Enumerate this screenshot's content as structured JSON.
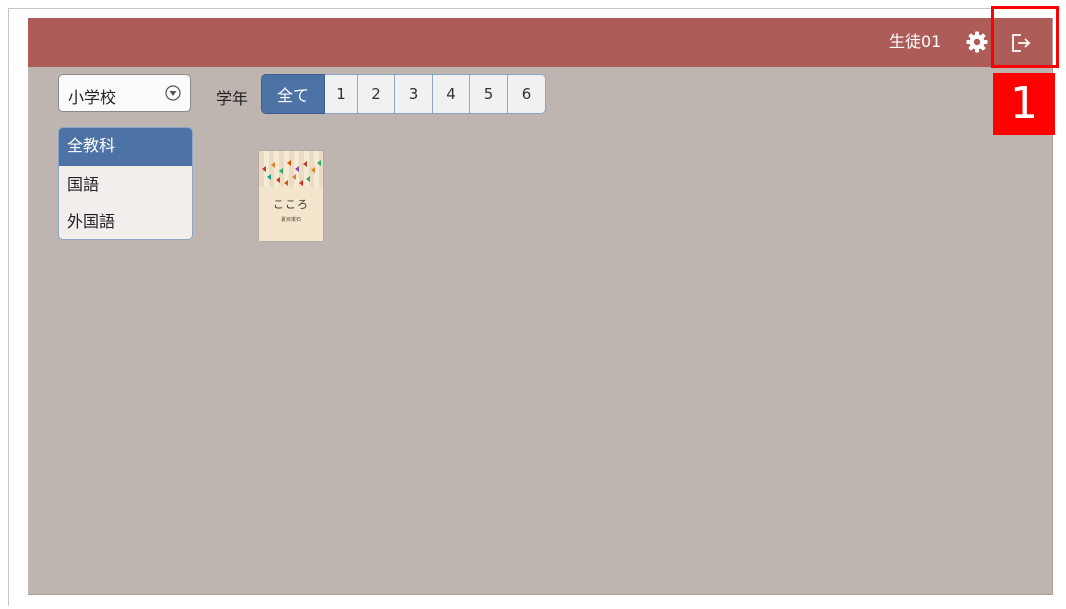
{
  "header": {
    "username": "生徒01",
    "settings_icon": "gear-icon",
    "logout_icon": "logout-icon"
  },
  "filters": {
    "school_select": {
      "selected": "小学校",
      "icon": "chevron-down-circle-icon"
    },
    "grade_label": "学年",
    "grades": [
      {
        "label": "全て",
        "active": true
      },
      {
        "label": "1",
        "active": false
      },
      {
        "label": "2",
        "active": false
      },
      {
        "label": "3",
        "active": false
      },
      {
        "label": "4",
        "active": false
      },
      {
        "label": "5",
        "active": false
      },
      {
        "label": "6",
        "active": false
      }
    ]
  },
  "subjects": [
    {
      "label": "全教科",
      "active": true
    },
    {
      "label": "国語",
      "active": false
    },
    {
      "label": "外国語",
      "active": false
    }
  ],
  "books": [
    {
      "title": "こころ",
      "author": "夏目漱石"
    }
  ],
  "annotation": {
    "step_number": "1"
  },
  "colors": {
    "header": "#ad5c57",
    "background": "#bfb5b0",
    "active": "#4d73a6",
    "highlight": "#ff0000"
  }
}
